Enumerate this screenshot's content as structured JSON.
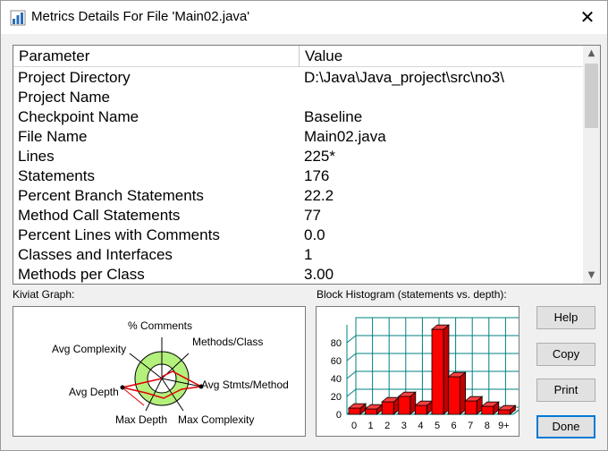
{
  "window": {
    "title": "Metrics Details For File 'Main02.java'"
  },
  "table": {
    "headers": [
      "Parameter",
      "Value"
    ],
    "rows": [
      [
        "Project Directory",
        "D:\\Java\\Java_project\\src\\no3\\"
      ],
      [
        "Project Name",
        ""
      ],
      [
        "Checkpoint Name",
        "Baseline"
      ],
      [
        "File Name",
        "Main02.java"
      ],
      [
        "Lines",
        "225*"
      ],
      [
        "Statements",
        "176"
      ],
      [
        "Percent Branch Statements",
        "22.2"
      ],
      [
        "Method Call Statements",
        "77"
      ],
      [
        "Percent Lines with Comments",
        "0.0"
      ],
      [
        "Classes and Interfaces",
        "1"
      ],
      [
        "Methods per Class",
        "3.00"
      ]
    ]
  },
  "kiviat": {
    "label": "Kiviat Graph:",
    "axes": [
      "% Comments",
      "Methods/Class",
      "Avg Stmts/Method",
      "Max Complexity",
      "Max Depth",
      "Avg Depth",
      "Avg Complexity"
    ]
  },
  "histogram": {
    "label": "Block Histogram (statements vs. depth):"
  },
  "chart_data": {
    "type": "bar",
    "title": "Block Histogram (statements vs. depth):",
    "categories": [
      "0",
      "1",
      "2",
      "3",
      "4",
      "5",
      "6",
      "7",
      "8",
      "9+"
    ],
    "values": [
      7,
      6,
      14,
      20,
      10,
      95,
      42,
      15,
      9,
      5
    ],
    "ylim": [
      0,
      100
    ],
    "yticks": [
      0,
      20,
      40,
      60,
      80
    ],
    "grid": true,
    "bar_color": "#ff0000"
  },
  "buttons": {
    "help": "Help",
    "copy": "Copy",
    "print": "Print",
    "done": "Done"
  }
}
